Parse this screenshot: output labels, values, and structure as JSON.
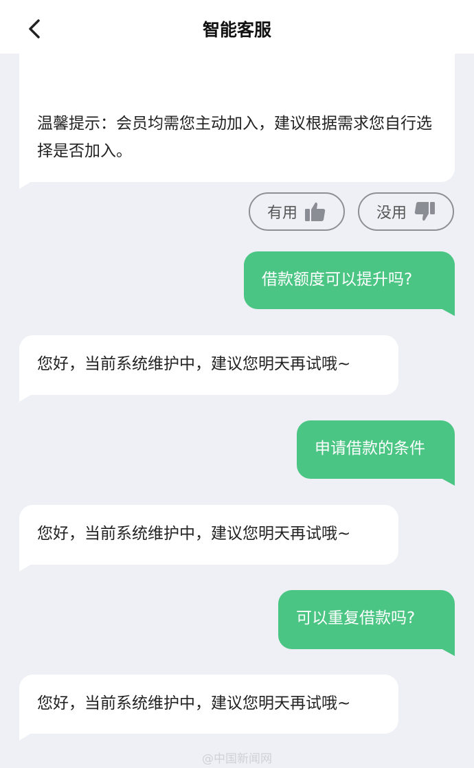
{
  "header": {
    "title": "智能客服",
    "back_icon": "chevron-left-icon"
  },
  "messages": [
    {
      "side": "left",
      "text": "温馨提示：会员均需您主动加入，建议根据需求您自行选择是否加入。"
    },
    {
      "side": "right",
      "text": "借款额度可以提升吗?"
    },
    {
      "side": "left",
      "text": "您好，当前系统维护中，建议您明天再试哦~"
    },
    {
      "side": "right",
      "text": "申请借款的条件"
    },
    {
      "side": "left",
      "text": "您好，当前系统维护中，建议您明天再试哦~"
    },
    {
      "side": "right",
      "text": "可以重复借款吗?"
    },
    {
      "side": "left",
      "text": "您好，当前系统维护中，建议您明天再试哦~"
    }
  ],
  "feedback": {
    "useful": "有用",
    "useless": "没用"
  },
  "watermark": "@中国新闻网",
  "colors": {
    "accent": "#4bc583",
    "background": "#eef0f5"
  }
}
